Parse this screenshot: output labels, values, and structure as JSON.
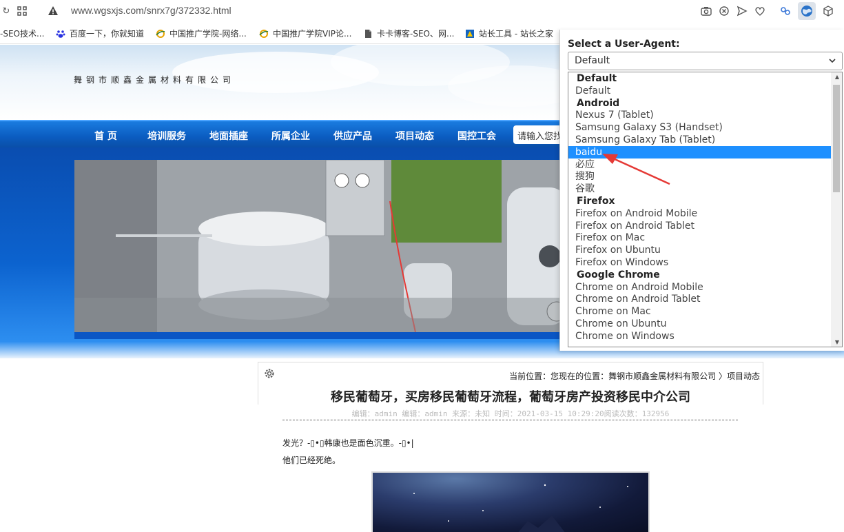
{
  "browser": {
    "url": "www.wgsxjs.com/snrx7g/372332.html",
    "bookmarks": [
      {
        "label": "-SEO技术...",
        "color": "#f0f0f0"
      },
      {
        "label": "百度一下，你就知道",
        "color": "#2932e1"
      },
      {
        "label": "中国推广学院-网络...",
        "color": "#e8a400"
      },
      {
        "label": "中国推广学院VIP论...",
        "color": "#e8a400"
      },
      {
        "label": "卡卡博客-SEO、网...",
        "color": "#555555"
      },
      {
        "label": "站长工具 - 站长之家",
        "color": "#1565c0"
      }
    ]
  },
  "site": {
    "company": "舞钢市顺鑫金属材料有限公司",
    "nav": [
      "首 页",
      "培训服务",
      "地面插座",
      "所属企业",
      "供应产品",
      "项目动态",
      "国控工会"
    ],
    "search_text": "请输入您找"
  },
  "article": {
    "breadcrumb": "当前位置：您现在的位置：舞钢市顺鑫金属材料有限公司 〉项目动态",
    "title": "移民葡萄牙，买房移民葡萄牙流程，葡萄牙房产投资移民中介公司",
    "meta": "编辑：admin 编辑：admin 来源：未知 时间：2021-03-15 10:29:20阅读次数：132956",
    "para1": "发光？-▯•▯韩康也是面色沉重。-▯•|",
    "para2": "他们已经死绝。"
  },
  "ua_popup": {
    "label": "Select a User-Agent:",
    "selected": "Default",
    "options": [
      {
        "text": "Default",
        "group": true
      },
      {
        "text": "Default"
      },
      {
        "text": "Android",
        "group": true
      },
      {
        "text": "Nexus 7 (Tablet)"
      },
      {
        "text": "Samsung Galaxy S3 (Handset)"
      },
      {
        "text": "Samsung Galaxy Tab (Tablet)"
      },
      {
        "text": "baidu",
        "highlighted": true
      },
      {
        "text": "必应"
      },
      {
        "text": "搜狗"
      },
      {
        "text": "谷歌"
      },
      {
        "text": "Firefox",
        "group": true
      },
      {
        "text": "Firefox on Android Mobile"
      },
      {
        "text": "Firefox on Android Tablet"
      },
      {
        "text": "Firefox on Mac"
      },
      {
        "text": "Firefox on Ubuntu"
      },
      {
        "text": "Firefox on Windows"
      },
      {
        "text": "Google Chrome",
        "group": true
      },
      {
        "text": "Chrome on Android Mobile"
      },
      {
        "text": "Chrome on Android Tablet"
      },
      {
        "text": "Chrome on Mac"
      },
      {
        "text": "Chrome on Ubuntu"
      },
      {
        "text": "Chrome on Windows"
      }
    ]
  },
  "colors": {
    "nav_blue": "#0b5cc0",
    "highlight": "#1e90ff",
    "arrow": "#e53935"
  }
}
